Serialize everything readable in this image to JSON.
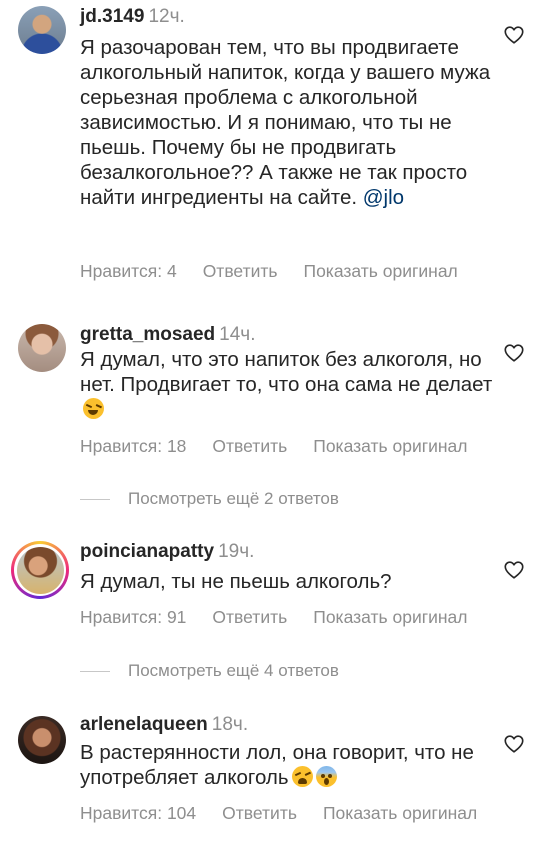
{
  "comments": [
    {
      "username": "jd.3149",
      "time": "12ч.",
      "text": "Я разочарован тем, что вы продвигаете алкогольный напиток, когда у вашего мужа серьезная проблема с алкогольной зависимостью. И я понимаю, что ты не пьешь. Почему бы не продвигать безалкогольное?? А также не так просто найти ингредиенты на сайте.",
      "mention": "@jlo",
      "likes": "Нравится: 4",
      "reply": "Ответить",
      "translate": "Показать оригинал"
    },
    {
      "username": "gretta_mosaed",
      "time": "14ч.",
      "text": "Я думал, что это напиток без алкоголя, но нет. Продвигает то, что она сама не делает",
      "emoji": [
        "grinning-squinting-face"
      ],
      "likes": "Нравится: 18",
      "reply": "Ответить",
      "translate": "Показать оригинал",
      "more_replies": "Посмотреть ещё 2 ответов"
    },
    {
      "username": "poincianapatty",
      "time": "19ч.",
      "text": "Я думал, ты не пьешь алкоголь?",
      "likes": "Нравится: 91",
      "reply": "Ответить",
      "translate": "Показать оригинал",
      "more_replies": "Посмотреть ещё 4 ответов"
    },
    {
      "username": "arlenelaqueen",
      "time": "18ч.",
      "text": "В растерянности лол, она говорит, что не употребляет алкоголь",
      "emoji": [
        "tired-face",
        "face-screaming-in-fear"
      ],
      "likes": "Нравится: 104",
      "reply": "Ответить",
      "translate": "Показать оригинал"
    }
  ],
  "icons": {
    "like": "heart-outline-icon"
  },
  "colors": {
    "text": "#262626",
    "secondary": "#8e8e8e",
    "mention": "#00376b",
    "divider": "#c7c7c7"
  }
}
